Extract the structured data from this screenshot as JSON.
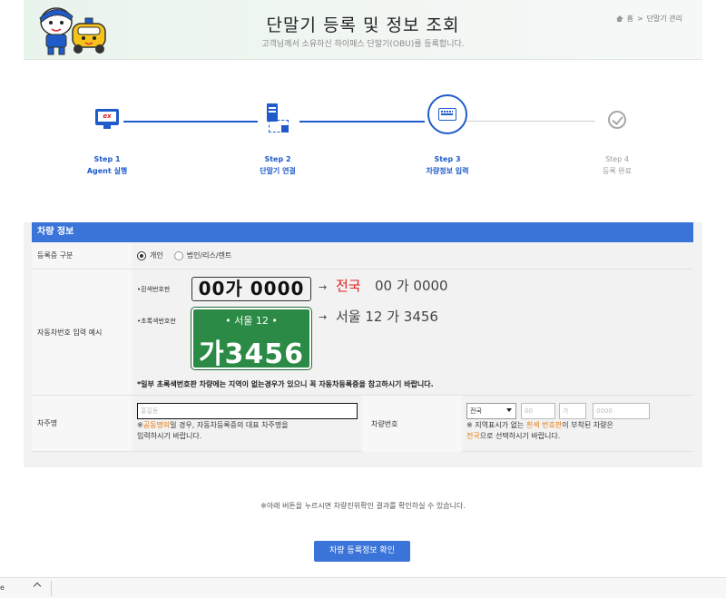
{
  "header": {
    "title": "단말기 등록 및 정보 조회",
    "subtitle": "고객님께서 소유하신 하이패스 단말기(OBU)를 등록합니다.",
    "breadcrumb": [
      "홈",
      ">",
      "단말기 관리"
    ],
    "mascot": "hipass-mascots"
  },
  "steps": [
    {
      "step": "Step 1",
      "label": "Agent 실행",
      "icon": "ex-monitor-icon",
      "state": "done"
    },
    {
      "step": "Step 2",
      "label": "단말기 연결",
      "icon": "device-connect-icon",
      "state": "done"
    },
    {
      "step": "Step 3",
      "label": "차량정보 입력",
      "icon": "keyboard-icon",
      "state": "active"
    },
    {
      "step": "Step 4",
      "label": "등록 완료",
      "icon": "check-circle-icon",
      "state": "pending"
    }
  ],
  "form": {
    "section_title": "차량 정보",
    "registration_type": {
      "label": "등록증 구분",
      "options": [
        "개인",
        "법인/리스/렌트"
      ],
      "selected": "개인"
    },
    "plate_example": {
      "label": "자동차번호 입력 예시",
      "white_label": "•흰색번호판",
      "white_plate": "00가 0000",
      "white_arrow": "→",
      "white_region": "전국",
      "white_rest": "00 가 0000",
      "green_label": "•초록색번호판",
      "green_plate_top": "•  서울 12  •",
      "green_plate_bottom": "가3456",
      "green_arrow": "→",
      "green_text": "서울 12 가 3456",
      "warning": "*일부 초록색번호판 차량에는 지역이 없는경우가 있으니 꼭 자동차등록증을 참고하시기 바랍니다."
    },
    "owner": {
      "label": "차주명",
      "placeholder": "홍길동",
      "note_prefix": "※",
      "note_highlight": "공동명의",
      "note_rest": "일 경우, 자동차등록증의 대표 차주명을",
      "note_line2": "입력하시기 바랍니다."
    },
    "vehicle_number": {
      "label": "차량번호",
      "region_selected": "전국",
      "field1_placeholder": "00",
      "field2_placeholder": "가",
      "field3_placeholder": "0000",
      "note_prefix": "※ 지역표시가 없는 ",
      "note_highlight": "흰색 번호판",
      "note_rest": "이 부착된 차량은",
      "note2_highlight": "전국",
      "note2_rest": "으로 선택하시기 바랍니다."
    }
  },
  "info_text": "※아래 버튼을 누르시면 차량진위확인 결과를 확인하실 수 있습니다.",
  "confirm_button": "차량 등록정보 확인",
  "download_bar": {
    "text": "e"
  },
  "colors": {
    "primary": "#3b74d9",
    "step_active": "#1f5cc9",
    "highlight": "#e57b12",
    "red": "#e0201e",
    "green_plate": "#2b8a45"
  }
}
